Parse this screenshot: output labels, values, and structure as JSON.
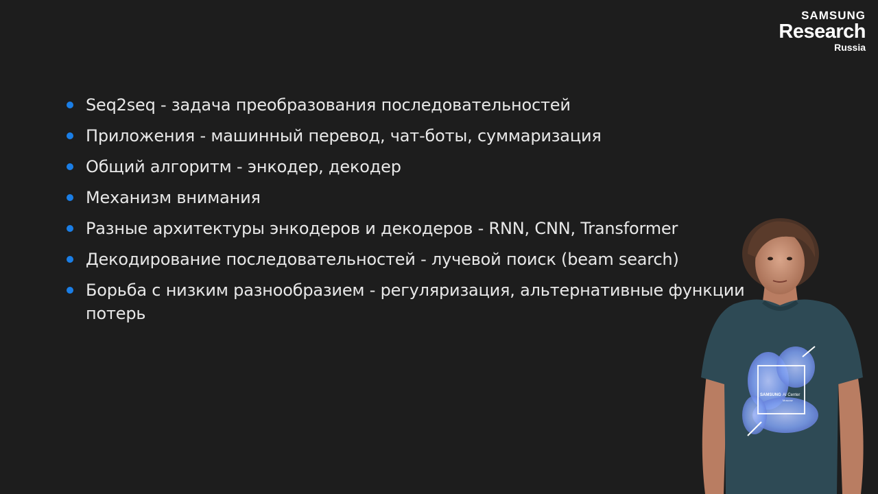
{
  "logo": {
    "brand": "SAMSUNG",
    "research": "Research",
    "region": "Russia"
  },
  "bullets": [
    "Seq2seq - задача преобразования последовательностей",
    "Приложения - машинный перевод, чат-боты, суммаризация",
    "Общий алгоритм - энкодер, декодер",
    "Механизм внимания",
    "Разные архитектуры энкодеров и декодеров - RNN, CNN, Transformer",
    "Декодирование последовательностей - лучевой поиск (beam search)",
    "Борьба с низким разнообразием - регуляризация, альтернативные функции потерь"
  ],
  "colors": {
    "background": "#1d1d1d",
    "bullet": "#1a7ee6",
    "text": "#e8e8e8",
    "shirt": "#2e4a55",
    "print": "#7fa2ee"
  },
  "presenter": {
    "shirt_print_brand": "SAMSUNG",
    "shirt_print_title": "AI Center",
    "shirt_print_city": "Moscow"
  }
}
